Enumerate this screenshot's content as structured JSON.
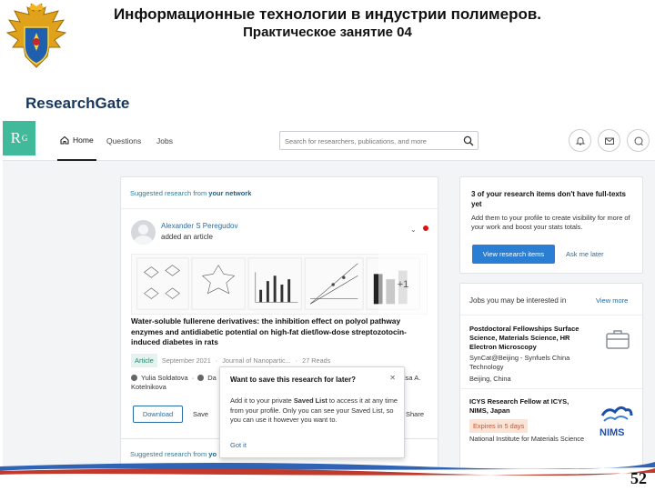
{
  "slide": {
    "title_line1": "Информационные технологии в индустрии полимеров.",
    "title_line2": "Практическое занятие 04",
    "section_label": "ResearchGate",
    "page_number": "52"
  },
  "screenshot": {
    "logo_text": "R",
    "logo_sup": "G",
    "nav": {
      "home": "Home",
      "questions": "Questions",
      "jobs": "Jobs"
    },
    "search_placeholder": "Search for researchers, publications, and more",
    "feed": {
      "header_prefix": "Suggested research from ",
      "header_emph": "your network",
      "author": "Alexander S Peregudov",
      "action": "added an article",
      "more_figures": "+1",
      "article_title": "Water-soluble fullerene derivatives: the inhibition effect on polyol pathway enzymes and antidiabetic potential on high-fat diet/low-dose streptozotocin-induced diabetes in rats",
      "type_badge": "Article",
      "date": "September 2021",
      "journal": "Journal of Nanopartic...",
      "reads": "27 Reads",
      "author1": "Yulia Soldatova",
      "author2": "Da",
      "author3_tail": "isa A.",
      "author_line2": "Kotelnikova",
      "download": "Download",
      "save": "Save",
      "share": "Share"
    },
    "popup": {
      "title": "Want to save this research for later?",
      "body_pre": "Add it to your private ",
      "body_bold": "Saved List",
      "body_post": " to access it at any time from your profile. Only you can see your Saved List, so you can use it however you want to.",
      "got_it": "Got it"
    },
    "feed2": {
      "header_prefix": "Suggested research from ",
      "header_emph": "yo"
    },
    "fulltext_card": {
      "title": "3 of your research items don't have full-texts yet",
      "body": "Add them to your profile to create visibility for more of your work and boost your stats totals.",
      "view_button": "View research items",
      "later": "Ask me later"
    },
    "jobs": {
      "header": "Jobs you may be interested in",
      "view_more": "View more",
      "job1": {
        "title": "Postdoctoral Fellowships Surface Science, Materials Science, HR Electron Microscopy",
        "org": "SynCat@Beijing - Synfuels China Technology",
        "location": "Beijing, China"
      },
      "job2": {
        "title": "ICYS Research Fellow at ICYS, NIMS, Japan",
        "expires": "Expires in 5 days",
        "org": "National Institute for Materials Science",
        "logo_text": "NIMS"
      }
    }
  }
}
